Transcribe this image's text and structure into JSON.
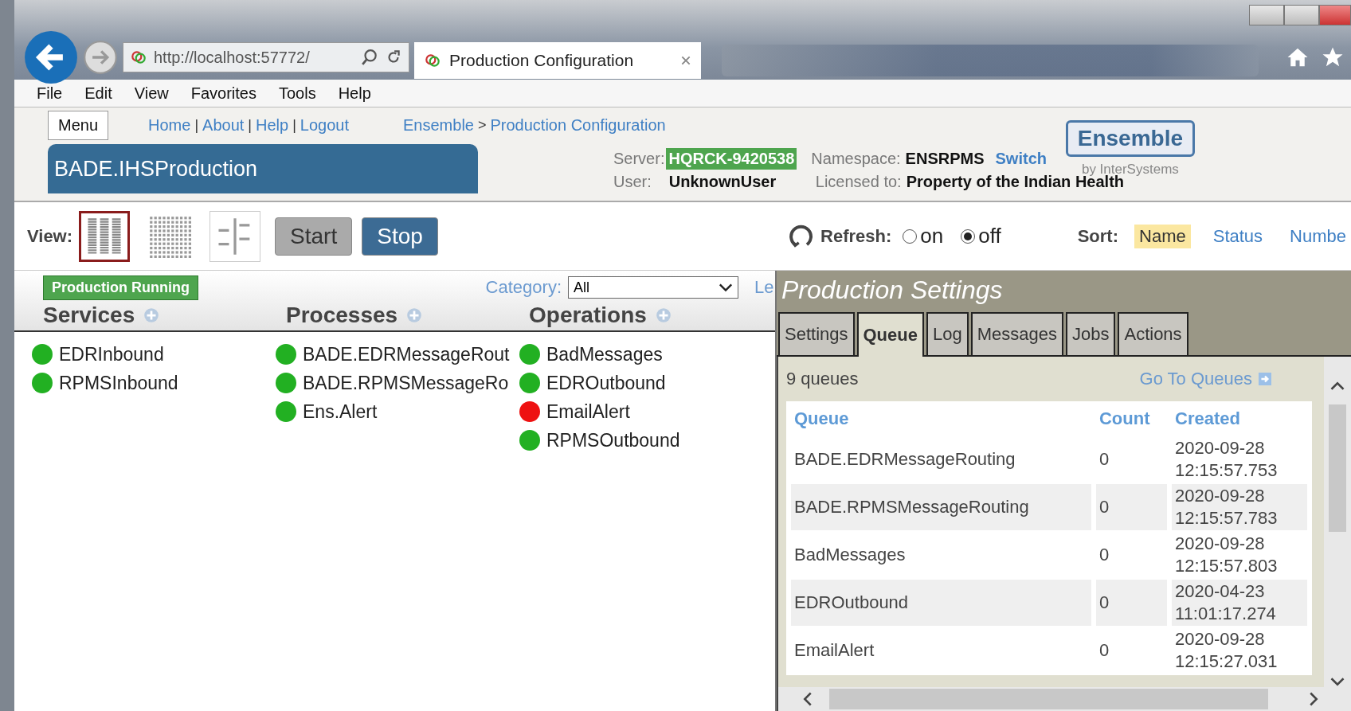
{
  "browser": {
    "address": "http://localhost:57772/",
    "tab_title": "Production Configuration"
  },
  "menu_bar": [
    "File",
    "Edit",
    "View",
    "Favorites",
    "Tools",
    "Help"
  ],
  "header": {
    "menu_button": "Menu",
    "links": [
      "Home",
      "About",
      "Help",
      "Logout"
    ],
    "link_separator": "|",
    "breadcrumb": [
      "Ensemble",
      "Production Configuration"
    ],
    "breadcrumb_separator": ">",
    "production": "BADE.IHSProduction",
    "server_label": "Server:",
    "server": "HQRCK-9420538",
    "user_label": "User:",
    "user": "UnknownUser",
    "namespace_label": "Namespace:",
    "namespace": "ENSRPMS",
    "switch_link": "Switch",
    "licensed_label": "Licensed to:",
    "licensed": "Property of the Indian Health",
    "logo": "Ensemble",
    "logo_sub": "by InterSystems"
  },
  "toolbar": {
    "view_label": "View:",
    "view_modes": [
      {
        "kind": "columns",
        "selected": true
      },
      {
        "kind": "grid",
        "selected": false
      },
      {
        "kind": "tree",
        "selected": false
      }
    ],
    "buttons": [
      {
        "label": "Start",
        "kind": "secondary"
      },
      {
        "label": "Stop",
        "kind": "primary"
      }
    ],
    "refresh_label": "Refresh:",
    "refresh_options": [
      {
        "label": "on",
        "selected": false
      },
      {
        "label": "off",
        "selected": true
      }
    ],
    "sort_label": "Sort:",
    "sort_options": [
      {
        "label": "Name",
        "selected": true
      },
      {
        "label": "Status",
        "selected": false
      },
      {
        "label": "Numbe",
        "selected": false
      }
    ]
  },
  "diagram": {
    "status": "Production Running",
    "category_label": "Category:",
    "category": "All",
    "legend_link": "Le",
    "columns": [
      {
        "title": "Services",
        "items": [
          {
            "name": "EDRInbound",
            "color": "#22b022"
          },
          {
            "name": "RPMSInbound",
            "color": "#22b022"
          }
        ]
      },
      {
        "title": "Processes",
        "items": [
          {
            "name": "BADE.EDRMessageRout",
            "color": "#22b022"
          },
          {
            "name": "BADE.RPMSMessageRo",
            "color": "#22b022"
          },
          {
            "name": "Ens.Alert",
            "color": "#22b022"
          }
        ]
      },
      {
        "title": "Operations",
        "items": [
          {
            "name": "BadMessages",
            "color": "#22b022"
          },
          {
            "name": "EDROutbound",
            "color": "#22b022"
          },
          {
            "name": "EmailAlert",
            "color": "#ee1111"
          },
          {
            "name": "RPMSOutbound",
            "color": "#22b022"
          }
        ]
      }
    ]
  },
  "settings_panel": {
    "title": "Production Settings",
    "tabs": [
      {
        "label": "Settings",
        "selected": false
      },
      {
        "label": "Queue",
        "selected": true
      },
      {
        "label": "Log",
        "selected": false
      },
      {
        "label": "Messages",
        "selected": false
      },
      {
        "label": "Jobs",
        "selected": false
      },
      {
        "label": "Actions",
        "selected": false
      }
    ],
    "queue_count": "9 queues",
    "go_link": "Go To Queues",
    "table": {
      "columns": [
        "Queue",
        "Count",
        "Created"
      ],
      "rows": [
        {
          "queue": "BADE.EDRMessageRouting",
          "count": "0",
          "created": [
            "2020-09-28",
            "12:15:57.753"
          ]
        },
        {
          "queue": "BADE.RPMSMessageRouting",
          "count": "0",
          "created": [
            "2020-09-28",
            "12:15:57.783"
          ]
        },
        {
          "queue": "BadMessages",
          "count": "0",
          "created": [
            "2020-09-28",
            "12:15:57.803"
          ]
        },
        {
          "queue": "EDROutbound",
          "count": "0",
          "created": [
            "2020-04-23",
            "11:01:17.274"
          ]
        },
        {
          "queue": "EmailAlert",
          "count": "0",
          "created": [
            "2020-09-28",
            "12:15:27.031"
          ]
        }
      ]
    }
  }
}
